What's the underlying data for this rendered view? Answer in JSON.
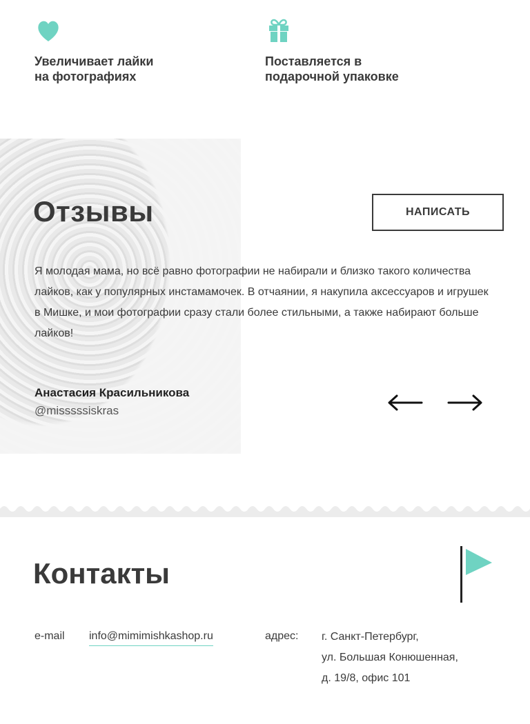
{
  "features": [
    {
      "icon": "heart-icon",
      "text": "Увеличивает лайки\nна фотографиях"
    },
    {
      "icon": "gift-icon",
      "text": "Поставляется в\nподарочной упаковке"
    }
  ],
  "reviews": {
    "title": "Отзывы",
    "write_button": "НАПИСАТЬ",
    "text": "Я молодая мама, но всё равно фотографии не набирали и близко такого количества лайков, как у популярных инстамамочек. В отчаянии, я накупила аксессуаров и игрушек в Мишке, и мои фотографии сразу стали более стильными, а также набирают больше лайков!",
    "author_name": "Анастасия Красильникова",
    "author_handle": "@misssssiskras"
  },
  "contacts": {
    "title": "Контакты",
    "email_label": "e-mail",
    "email": "info@mimimishkashop.ru",
    "address_label": "адрес:",
    "address_lines": [
      "г. Санкт-Петербург,",
      "ул. Большая Конюшенная,",
      "д. 19/8, офис 101"
    ]
  },
  "colors": {
    "accent": "#6fd3c2",
    "text": "#3a3a3a"
  }
}
